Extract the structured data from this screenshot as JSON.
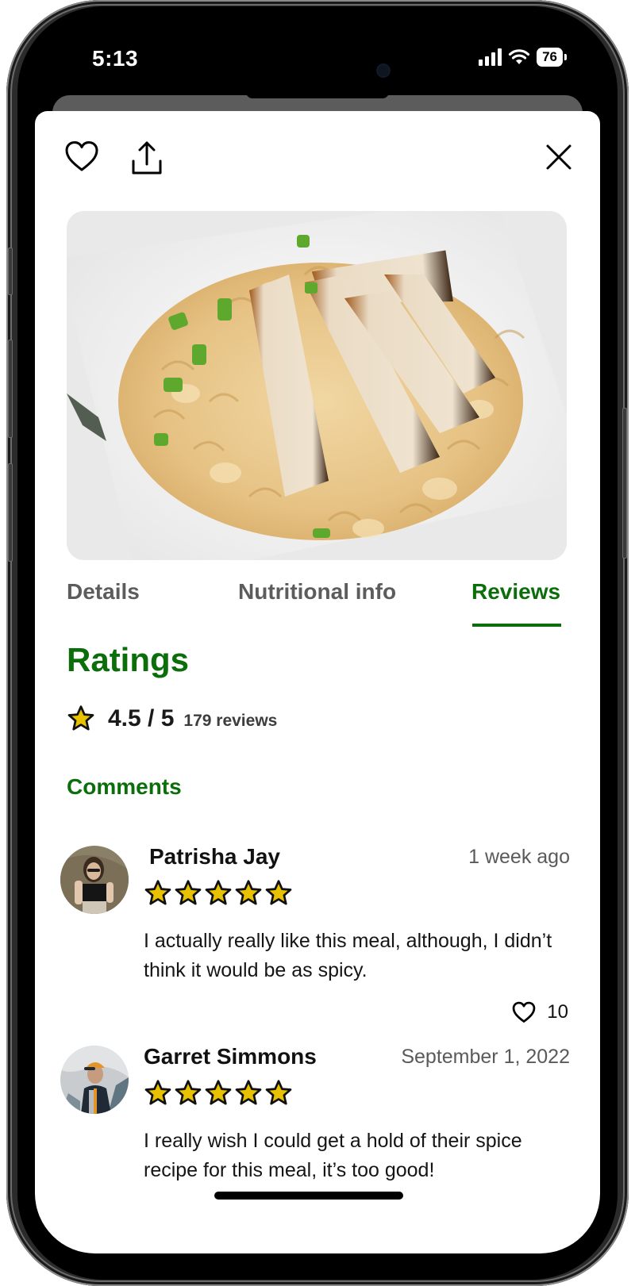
{
  "status_bar": {
    "time": "5:13",
    "battery": "76"
  },
  "top_actions": {
    "favorite_icon": "heart-outline-icon",
    "share_icon": "share-upload-icon",
    "close_icon": "close-x-icon"
  },
  "hero_image": {
    "alt": "Blackened chicken slices over creamy macaroni pasta with jalapeños on a white plate"
  },
  "tabs": [
    {
      "label": "Details",
      "active": false
    },
    {
      "label": "Nutritional info",
      "active": false
    },
    {
      "label": "Reviews",
      "active": true
    }
  ],
  "ratings": {
    "title": "Ratings",
    "value": "4.5 / 5",
    "count": "179 reviews",
    "score": 4.5,
    "max": 5
  },
  "comments": {
    "title": "Comments",
    "items": [
      {
        "name": "Patrisha Jay",
        "date": "1 week ago",
        "stars": 5,
        "text": "I actually really like this meal, although, I didn’t think it would be as spicy.",
        "likes": "10"
      },
      {
        "name": "Garret Simmons",
        "date": "September 1, 2022",
        "stars": 5,
        "text": "I really wish I could get a hold of their spice recipe for this meal, it’s too good!"
      }
    ]
  },
  "colors": {
    "accent_green": "#0b6e0b",
    "star_fill": "#e8c100",
    "tab_inactive": "#5c5c5c"
  }
}
